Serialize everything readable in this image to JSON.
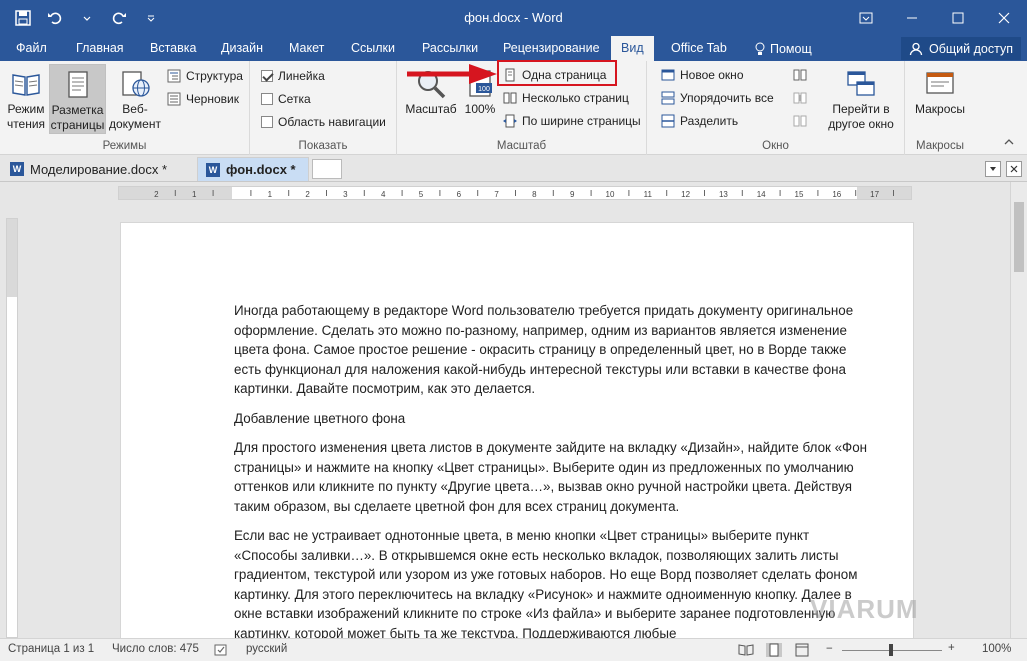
{
  "window": {
    "title": "фон.docx - Word"
  },
  "tabs": [
    "Файл",
    "Главная",
    "Вставка",
    "Дизайн",
    "Макет",
    "Ссылки",
    "Рассылки",
    "Рецензирование",
    "Вид",
    "Office Tab"
  ],
  "active_tab": "Вид",
  "tell_me": "Помощ",
  "share_label": "Общий доступ",
  "ribbon": {
    "modes": {
      "label": "Режимы",
      "read_mode": "Режим\nчтения",
      "print_layout": "Разметка\nстраницы",
      "web_layout": "Веб-\nдокумент",
      "outline": "Структура",
      "draft": "Черновик"
    },
    "show": {
      "label": "Показать",
      "ruler": "Линейка",
      "ruler_checked": true,
      "grid": "Сетка",
      "grid_checked": false,
      "nav_pane": "Область навигации",
      "nav_checked": false
    },
    "zoom": {
      "label": "Масштаб",
      "zoom_btn": "Масштаб",
      "hundred": "100%",
      "one_page": "Одна страница",
      "multiple_pages": "Несколько страниц",
      "page_width": "По ширине страницы"
    },
    "window": {
      "label": "Окно",
      "new_window": "Новое окно",
      "arrange_all": "Упорядочить все",
      "split": "Разделить",
      "switch_windows": "Перейти в\nдругое окно"
    },
    "macros": {
      "label": "Макросы",
      "macros_btn": "Макросы"
    }
  },
  "doc_tabs": [
    {
      "name": "Моделирование.docx *",
      "active": false
    },
    {
      "name": "фон.docx *",
      "active": true
    }
  ],
  "document": {
    "paragraphs": [
      "Иногда работающему в редакторе Word пользователю требуется придать документу оригинальное оформление. Сделать это можно по-разному, например, одним из вариантов является изменение цвета фона. Самое простое решение - окрасить страницу в определенный цвет, но в Ворде также есть функционал для наложения какой-нибудь интересной текстуры или вставки в качестве фона картинки. Давайте посмотрим, как это делается.",
      "Добавление цветного фона",
      "Для простого изменения цвета листов в документе зайдите на вкладку «Дизайн», найдите блок «Фон страницы» и нажмите на кнопку «Цвет страницы». Выберите один из предложенных по умолчанию оттенков или кликните по пункту «Другие цвета…», вызвав окно ручной настройки цвета. Действуя таким образом, вы сделаете цветной фон для всех страниц документа.",
      "Если вас не устраивает однотонные цвета, в меню кнопки «Цвет страницы» выберите пункт «Способы заливки…». В открывшемся окне есть несколько вкладок, позволяющих залить листы градиентом, текстурой или узором из уже готовых наборов. Но еще Ворд позволяет сделать фоном картинку. Для этого переключитесь на вкладку «Рисунок» и нажмите одноименную кнопку. Далее в окне вставки изображений кликните по строке «Из файла» и выберите заранее подготовленную картинку, которой может быть та же текстура. Поддерживаются любые"
    ]
  },
  "status": {
    "page": "Страница 1 из 1",
    "words": "Число слов: 475",
    "language": "русский",
    "zoom": "100%"
  },
  "watermark": "VIARUM",
  "colors": {
    "brand": "#2b579a",
    "highlight": "#d6151f"
  }
}
